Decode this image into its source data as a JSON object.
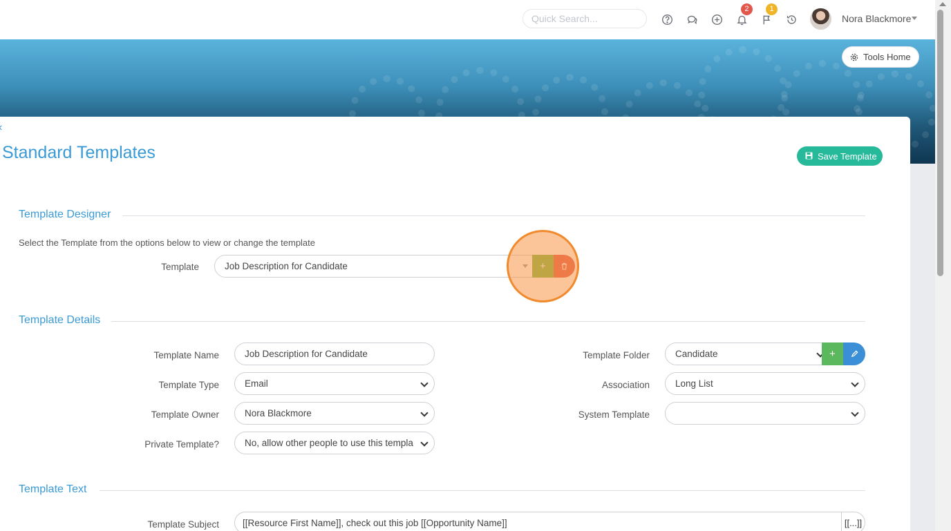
{
  "topbar": {
    "search_placeholder": "Quick Search...",
    "notifications_count": "2",
    "flags_count": "1",
    "user_name": "Nora Blackmore",
    "icons": [
      "help-icon",
      "chat-icon",
      "add-circle-icon",
      "bell-icon",
      "flag-icon",
      "history-icon"
    ]
  },
  "banner": {
    "tools_home_label": "Tools Home"
  },
  "page": {
    "title": "Standard Templates",
    "save_label": "Save Template"
  },
  "designer": {
    "section_title": "Template Designer",
    "hint": "Select the Template from the options below to view or change the template",
    "template_label": "Template",
    "template_value": "Job Description for Candidate",
    "add_symbol": "+"
  },
  "details": {
    "section_title": "Template Details",
    "name_label": "Template Name",
    "name_value": "Job Description for Candidate",
    "type_label": "Template Type",
    "type_value": "Email",
    "owner_label": "Template Owner",
    "owner_value": "Nora Blackmore",
    "private_label": "Private Template?",
    "private_value": "No, allow other people to use this templa",
    "folder_label": "Template Folder",
    "folder_value": "Candidate",
    "association_label": "Association",
    "association_value": "Long List",
    "system_label": "System Template",
    "system_value": "",
    "add_symbol": "+"
  },
  "text_section": {
    "section_title": "Template Text",
    "subject_label": "Template Subject",
    "subject_value": "[[Resource First Name]], check out this job [[Opportunity Name]]",
    "merge_button_label": "[[...]]"
  },
  "colors": {
    "accent": "#3a9ad6",
    "save_button": "#26b99a",
    "add_button": "#5cb85c",
    "delete_button": "#e05a4a",
    "edit_button": "#3a8fd6",
    "highlight": "#f08a2c"
  }
}
